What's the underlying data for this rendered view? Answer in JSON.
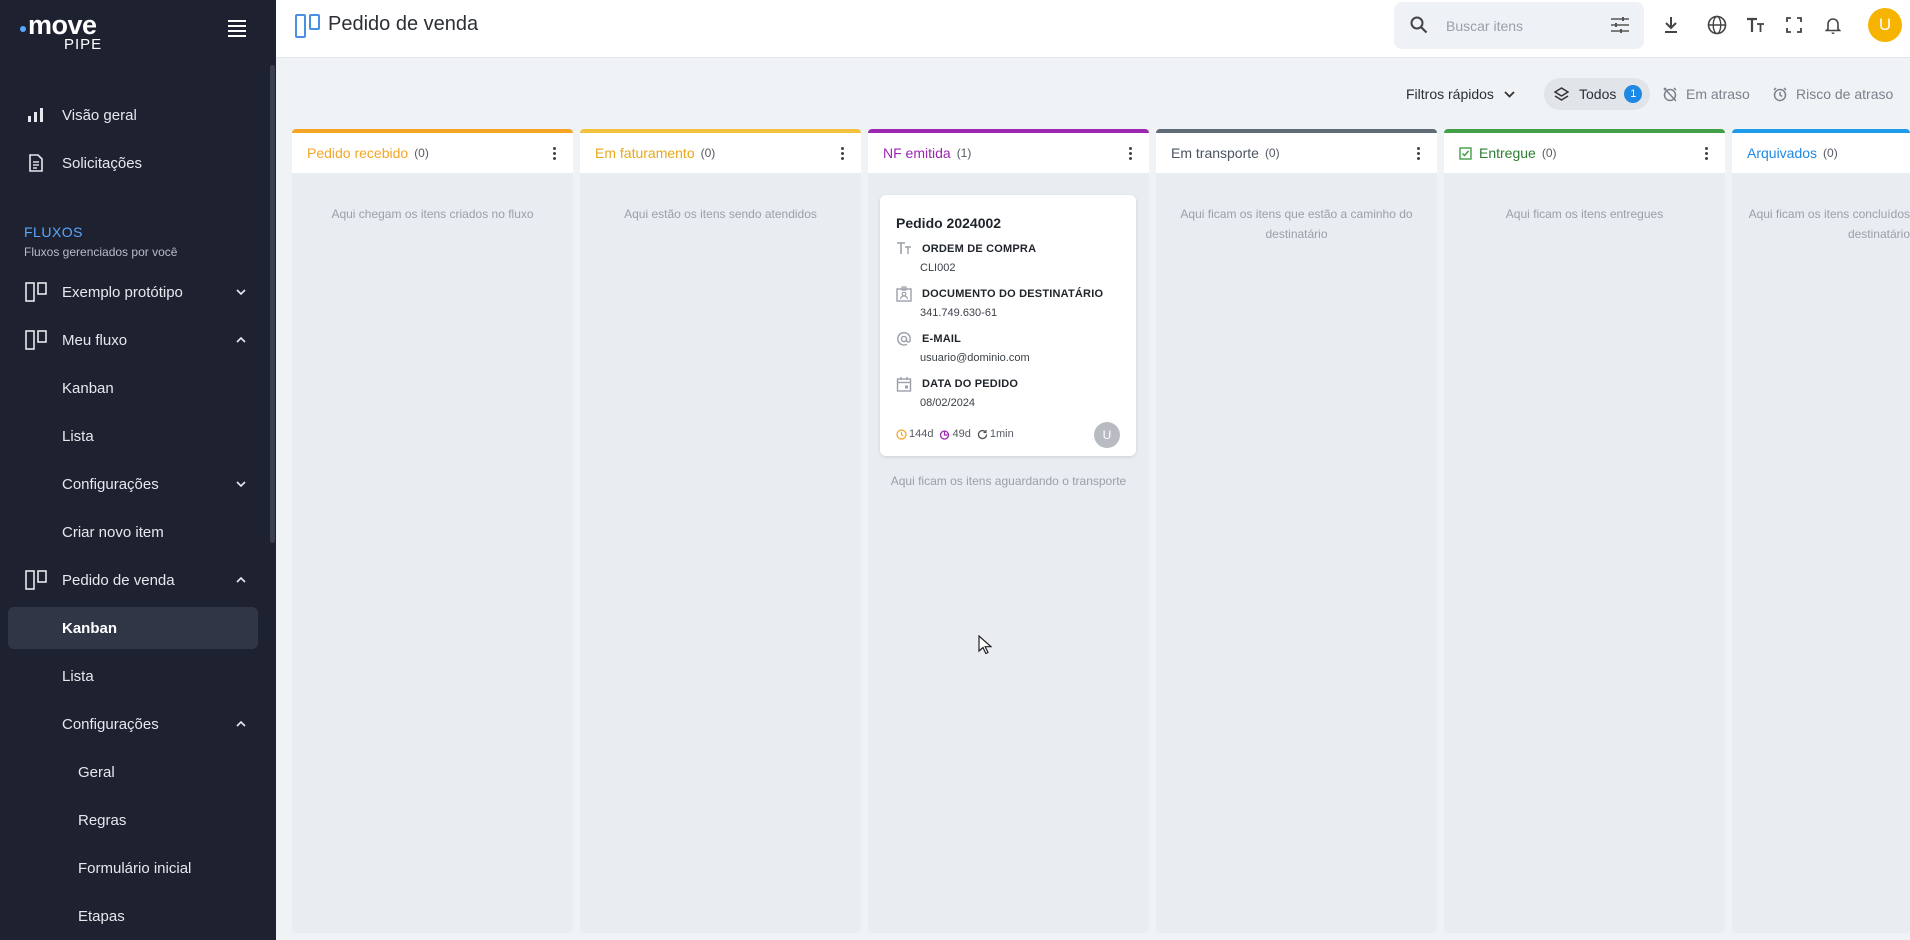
{
  "app": {
    "logo_main": "move",
    "logo_sub": "PIPE",
    "brand_color": "#5aa7ff"
  },
  "sidebar": {
    "top_items": [
      {
        "label": "Visão geral",
        "icon": "bar-chart-icon"
      },
      {
        "label": "Solicitações",
        "icon": "document-icon"
      }
    ],
    "section_title": "FLUXOS",
    "section_subtitle": "Fluxos gerenciados por você",
    "flows": [
      {
        "label": "Exemplo protótipo",
        "expanded": false
      },
      {
        "label": "Meu fluxo",
        "expanded": true
      },
      {
        "label": "Kanban"
      },
      {
        "label": "Lista"
      },
      {
        "label": "Configurações",
        "expanded": false
      },
      {
        "label": "Criar novo item"
      },
      {
        "label": "Pedido de venda",
        "expanded": true
      },
      {
        "label": "Kanban",
        "active": true
      },
      {
        "label": "Lista"
      },
      {
        "label": "Configurações",
        "expanded": true
      },
      {
        "label": "Geral"
      },
      {
        "label": "Regras"
      },
      {
        "label": "Formulário inicial"
      },
      {
        "label": "Etapas"
      }
    ]
  },
  "topbar": {
    "title": "Pedido de venda",
    "search_placeholder": "Buscar itens",
    "avatar_initial": "U",
    "avatar_color": "#f6b300"
  },
  "filters": {
    "quick": "Filtros rápidos",
    "all": "Todos",
    "all_count": "1",
    "late": "Em atraso",
    "risk": "Risco de atraso"
  },
  "columns": [
    {
      "title": "Pedido recebido",
      "count": "(0)",
      "color": "#f5a524",
      "empty": "Aqui chegam os itens criados no fluxo"
    },
    {
      "title": "Em faturamento",
      "count": "(0)",
      "color": "#f3c23d",
      "empty": "Aqui estão os itens sendo atendidos"
    },
    {
      "title": "NF emitida",
      "count": "(1)",
      "color": "#9c27b0",
      "empty": "Aqui ficam os itens aguardando o transporte"
    },
    {
      "title": "Em transporte",
      "count": "(0)",
      "color": "#5f6b76",
      "empty": "Aqui ficam os itens que estão a caminho do destinatário"
    },
    {
      "title": "Entregue",
      "count": "(0)",
      "color": "#43a047",
      "empty": "Aqui ficam os itens entregues"
    },
    {
      "title": "Arquivados",
      "count": "(0)",
      "color": "#1e9be9",
      "empty": "Aqui ficam os itens concluídos destinatário"
    }
  ],
  "card": {
    "title": "Pedido 2024002",
    "fields": [
      {
        "label": "ORDEM DE COMPRA",
        "value": "CLI002",
        "icon": "text-icon"
      },
      {
        "label": "DOCUMENTO DO DESTINATÁRIO",
        "value": "341.749.630-61",
        "icon": "id-card-icon"
      },
      {
        "label": "E-MAIL",
        "value": "usuario@dominio.com",
        "icon": "at-icon"
      },
      {
        "label": "DATA DO PEDIDO",
        "value": "08/02/2024",
        "icon": "calendar-icon"
      }
    ],
    "meta_total": "144d",
    "meta_stage": "49d",
    "meta_last": "1min",
    "avatar_initial": "U"
  }
}
